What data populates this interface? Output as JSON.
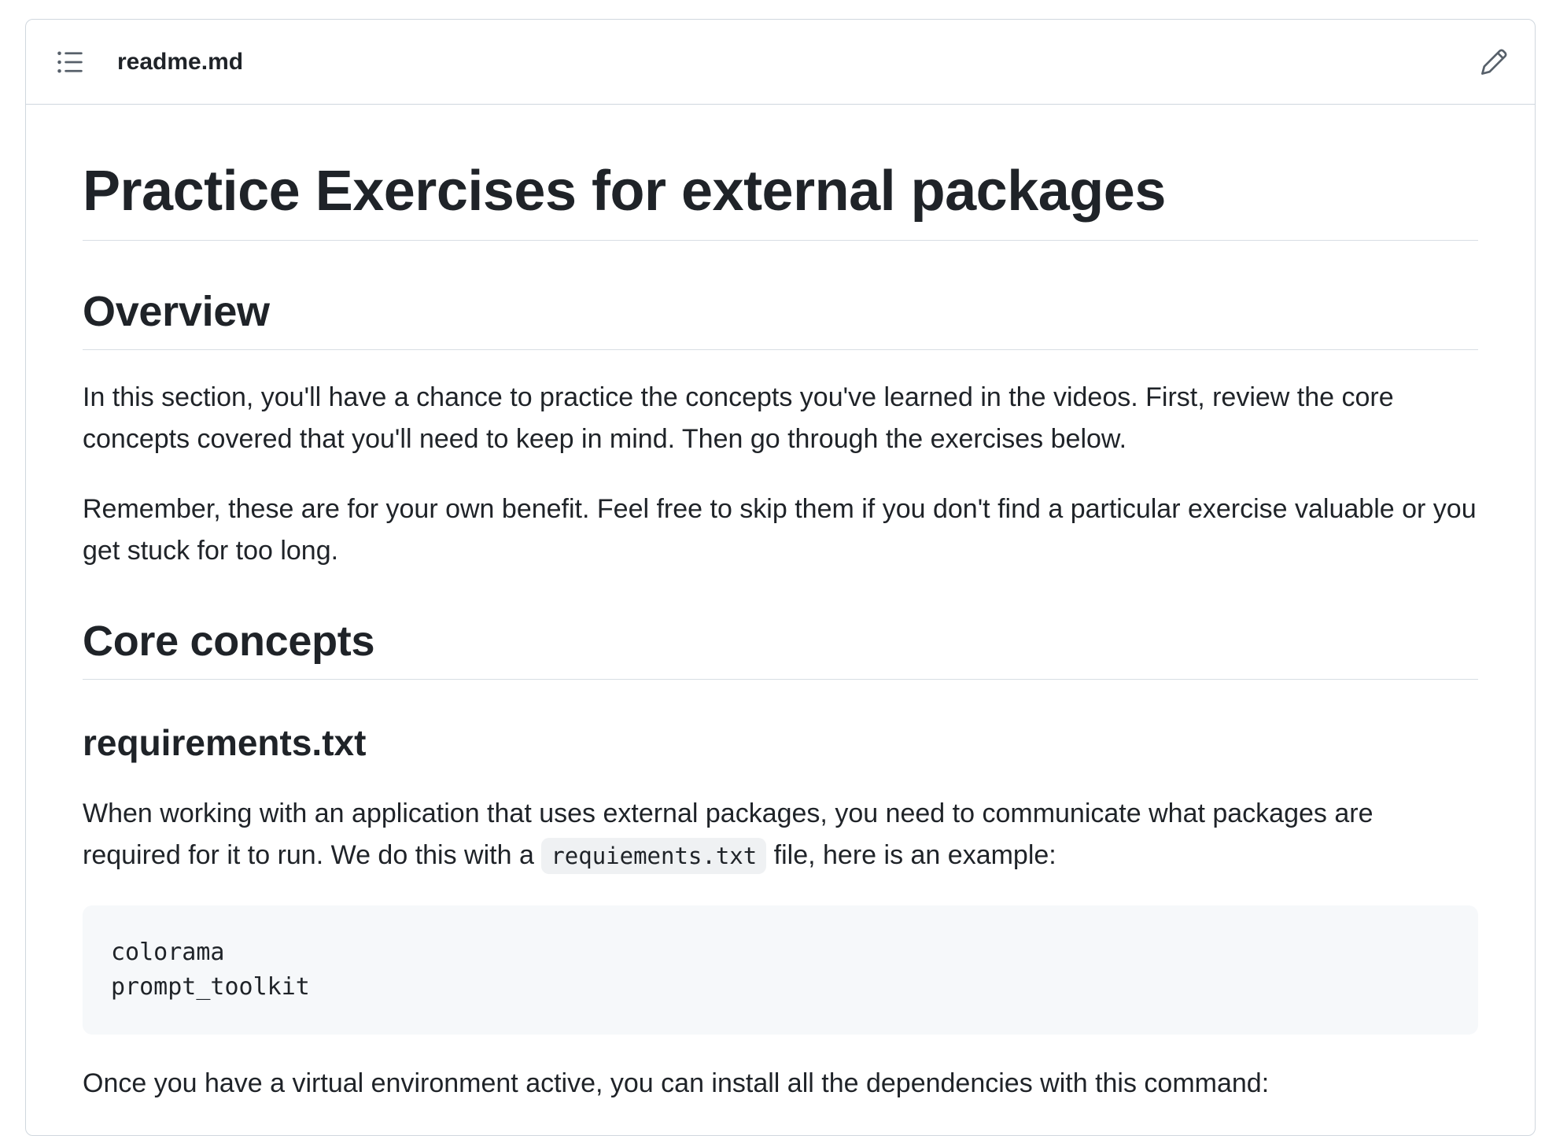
{
  "file_header": {
    "toc_icon": "list-unordered-icon",
    "file_name": "readme.md",
    "edit_icon": "pencil-icon"
  },
  "readme": {
    "title": "Practice Exercises for external packages",
    "overview_heading": "Overview",
    "overview_p1": "In this section, you'll have a chance to practice the concepts you've learned in the videos. First, review the core concepts covered that you'll need to keep in mind. Then go through the exercises below.",
    "overview_p2": "Remember, these are for your own benefit. Feel free to skip them if you don't find a particular exercise valuable or you get stuck for too long.",
    "core_heading": "Core concepts",
    "requirements_heading": "requirements.txt",
    "requirements_p_before": "When working with an application that uses external packages, you need to communicate what packages are required for it to run. We do this with a ",
    "requirements_code": "requiements.txt",
    "requirements_p_after": " file, here is an example:",
    "code_block": "colorama\nprompt_toolkit",
    "install_p": "Once you have a virtual environment active, you can install all the dependencies with this command:"
  },
  "colors": {
    "border": "#d0d7de",
    "text": "#1f2328",
    "code_bg": "#f6f8fa",
    "inline_code_bg": "#eff1f3"
  }
}
